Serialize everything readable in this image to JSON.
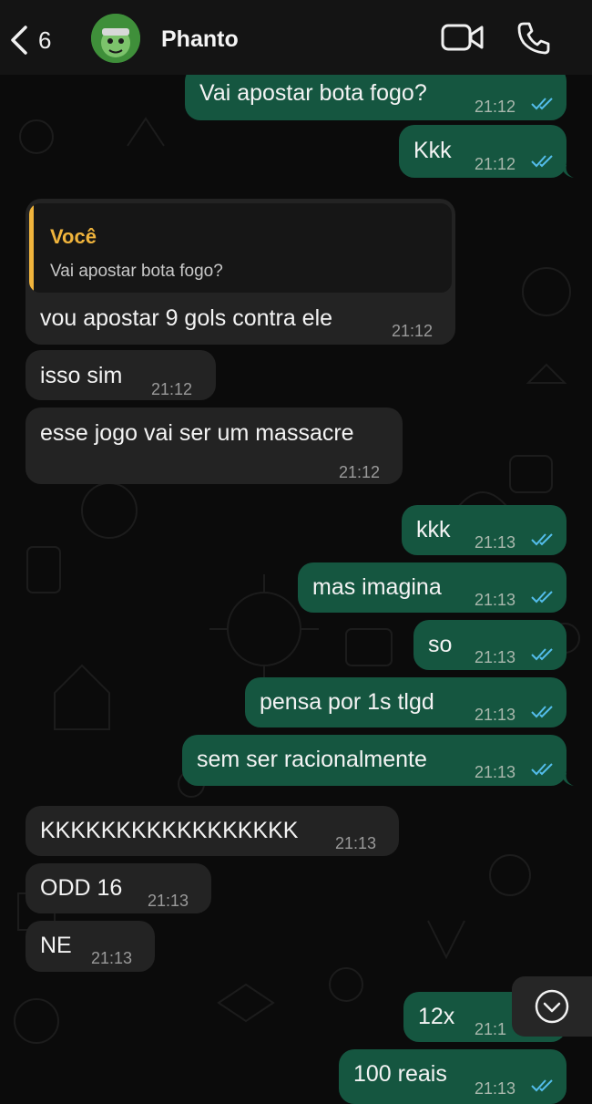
{
  "header": {
    "back_count": "6",
    "contact_name": "Phanto",
    "icons": [
      "chevron-left-icon",
      "video-camera-icon",
      "phone-icon"
    ]
  },
  "colors": {
    "background": "#0b0b0b",
    "header": "#141414",
    "outgoing_bubble": "#155640",
    "incoming_bubble": "#232323",
    "read_ticks": "#53bdeb",
    "quote_accent": "#f0b43c"
  },
  "messages": [
    {
      "dir": "out",
      "text": "Vai apostar bota fogo?",
      "time": "21:12"
    },
    {
      "dir": "out",
      "text": "Kkk",
      "time": "21:12"
    },
    {
      "dir": "in",
      "quote": {
        "author": "Você",
        "text": "Vai apostar bota fogo?"
      },
      "text": "vou apostar 9 gols contra ele",
      "time": "21:12"
    },
    {
      "dir": "in",
      "text": "isso sim",
      "time": "21:12"
    },
    {
      "dir": "in",
      "text": "esse jogo vai ser um massacre",
      "time": "21:12"
    },
    {
      "dir": "out",
      "text": "kkk",
      "time": "21:13"
    },
    {
      "dir": "out",
      "text": "mas imagina",
      "time": "21:13"
    },
    {
      "dir": "out",
      "text": "so",
      "time": "21:13"
    },
    {
      "dir": "out",
      "text": "pensa por 1s tlgd",
      "time": "21:13"
    },
    {
      "dir": "out",
      "text": "sem ser racionalmente",
      "time": "21:13"
    },
    {
      "dir": "in",
      "text": "KKKKKKKKKKKKKKKKK",
      "time": "21:13"
    },
    {
      "dir": "in",
      "text": "ODD 16",
      "time": "21:13"
    },
    {
      "dir": "in",
      "text": "NE",
      "time": "21:13"
    },
    {
      "dir": "out",
      "text": "12x",
      "time": "21:1"
    },
    {
      "dir": "out",
      "text": "100 reais",
      "time": "21:13"
    }
  ]
}
